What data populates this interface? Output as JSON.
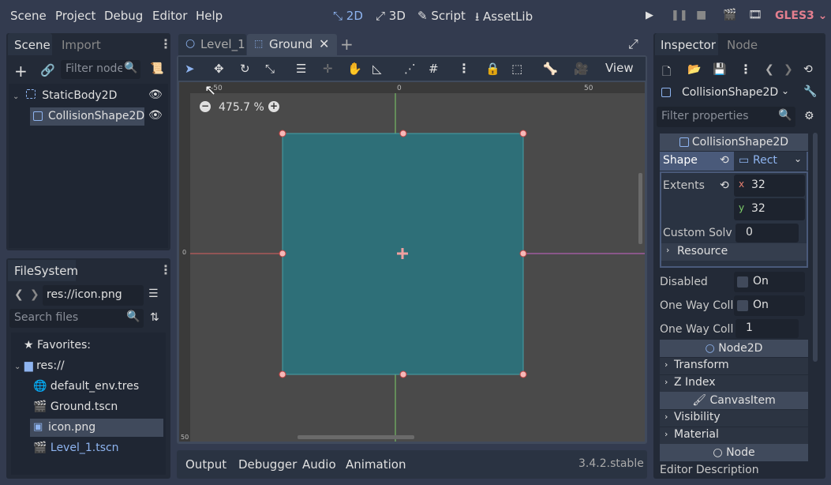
{
  "menu": {
    "scene": "Scene",
    "project": "Project",
    "debug": "Debug",
    "editor": "Editor",
    "help": "Help"
  },
  "workspaces": {
    "2d": "2D",
    "3d": "3D",
    "script": "Script",
    "assetlib": "AssetLib"
  },
  "renderer": "GLES3",
  "scene_dock": {
    "tab_scene": "Scene",
    "tab_import": "Import",
    "filter_placeholder": "Filter nodes",
    "nodes": [
      {
        "label": "StaticBody2D"
      },
      {
        "label": "CollisionShape2D"
      }
    ]
  },
  "filesystem": {
    "title": "FileSystem",
    "path": "res://icon.png",
    "search_placeholder": "Search files",
    "items": [
      {
        "label": "Favorites:"
      },
      {
        "label": "res://"
      },
      {
        "label": "default_env.tres"
      },
      {
        "label": "Ground.tscn"
      },
      {
        "label": "icon.png"
      },
      {
        "label": "Level_1.tscn"
      }
    ]
  },
  "editor_tabs": [
    {
      "label": "Level_1"
    },
    {
      "label": "Ground"
    }
  ],
  "viewport": {
    "zoom": "475.7 %",
    "view_label": "View",
    "ruler_labels": {
      "top_left": "-50",
      "top_mid": "0",
      "top_right": "50",
      "left_mid": "0",
      "left_bottom": "50"
    },
    "shape_color": "#2e6f78"
  },
  "bottom_panel": {
    "output": "Output",
    "debugger": "Debugger",
    "audio": "Audio",
    "animation": "Animation",
    "version": "3.4.2.stable"
  },
  "inspector": {
    "tab_inspector": "Inspector",
    "tab_node": "Node",
    "node_type": "CollisionShape2D",
    "filter_placeholder": "Filter properties",
    "section_collision": "CollisionShape2D",
    "shape_label": "Shape",
    "shape_value": "Rect",
    "extents_label": "Extents",
    "extents_x_label": "x",
    "extents_x": "32",
    "extents_y_label": "y",
    "extents_y": "32",
    "custom_solver_label": "Custom Solv",
    "custom_solver_value": "0",
    "resource_label": "Resource",
    "disabled_label": "Disabled",
    "disabled_value": "On",
    "one_way_label": "One Way Coll",
    "one_way_value": "On",
    "one_way_margin_label": "One Way Coll",
    "one_way_margin_value": "1",
    "section_node2d": "Node2D",
    "transform": "Transform",
    "zindex": "Z Index",
    "section_canvasitem": "CanvasItem",
    "visibility": "Visibility",
    "material": "Material",
    "section_node": "Node",
    "editor_description": "Editor Description"
  }
}
